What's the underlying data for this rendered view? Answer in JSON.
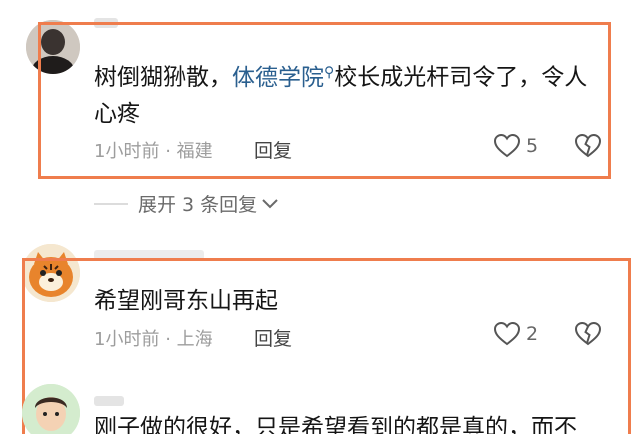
{
  "comments": [
    {
      "text_before": "树倒猢狲散，",
      "topic": "体德学院",
      "text_after": "校长成光杆司令了，令人心疼",
      "time": "1小时前",
      "location": "福建",
      "reply_label": "回复",
      "likes": "5",
      "highlighted": true
    },
    {
      "text": "希望刚哥东山再起",
      "time": "1小时前",
      "location": "上海",
      "reply_label": "回复",
      "likes": "2",
      "highlighted": true
    },
    {
      "text": "刚子做的很好，只是希望看到的都是真的，而不"
    }
  ],
  "expand_replies": {
    "label": "展开 3 条回复"
  },
  "colors": {
    "highlight_frame": "#ef7d4d",
    "topic_link": "#2a5f8f",
    "meta_text": "#9d9d9d"
  },
  "icons": [
    "heart-icon",
    "heart-broken-icon",
    "chevron-down-icon",
    "search-icon"
  ]
}
